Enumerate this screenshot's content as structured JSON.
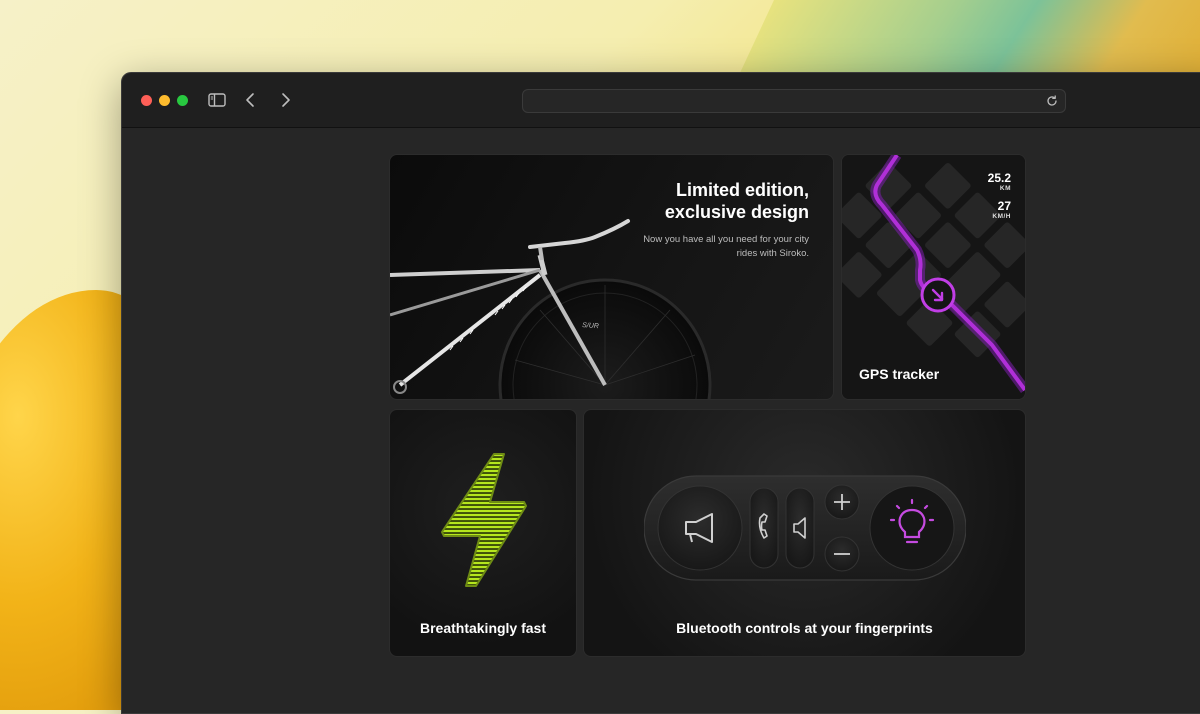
{
  "hero": {
    "title_line1": "Limited edition,",
    "title_line2": "exclusive design",
    "subtitle": "Now you have all you need for your city rides with Siroko."
  },
  "gps": {
    "distance_value": "25.2",
    "distance_unit": "KM",
    "speed_value": "27",
    "speed_unit": "KM/H",
    "label": "GPS tracker",
    "accent_color": "#b02fd8"
  },
  "fast": {
    "label": "Breathtakingly fast",
    "accent_color": "#b5e61d"
  },
  "bluetooth": {
    "label": "Bluetooth controls at your fingerprints",
    "light_color": "#c54be0"
  },
  "icons": {
    "sidebar": "sidebar-icon",
    "back": "chevron-left-icon",
    "forward": "chevron-right-icon",
    "reload": "reload-icon",
    "horn": "megaphone-icon",
    "phone": "phone-icon",
    "speaker": "speaker-icon",
    "plus": "plus-icon",
    "minus": "minus-icon",
    "light": "lightbulb-icon"
  }
}
